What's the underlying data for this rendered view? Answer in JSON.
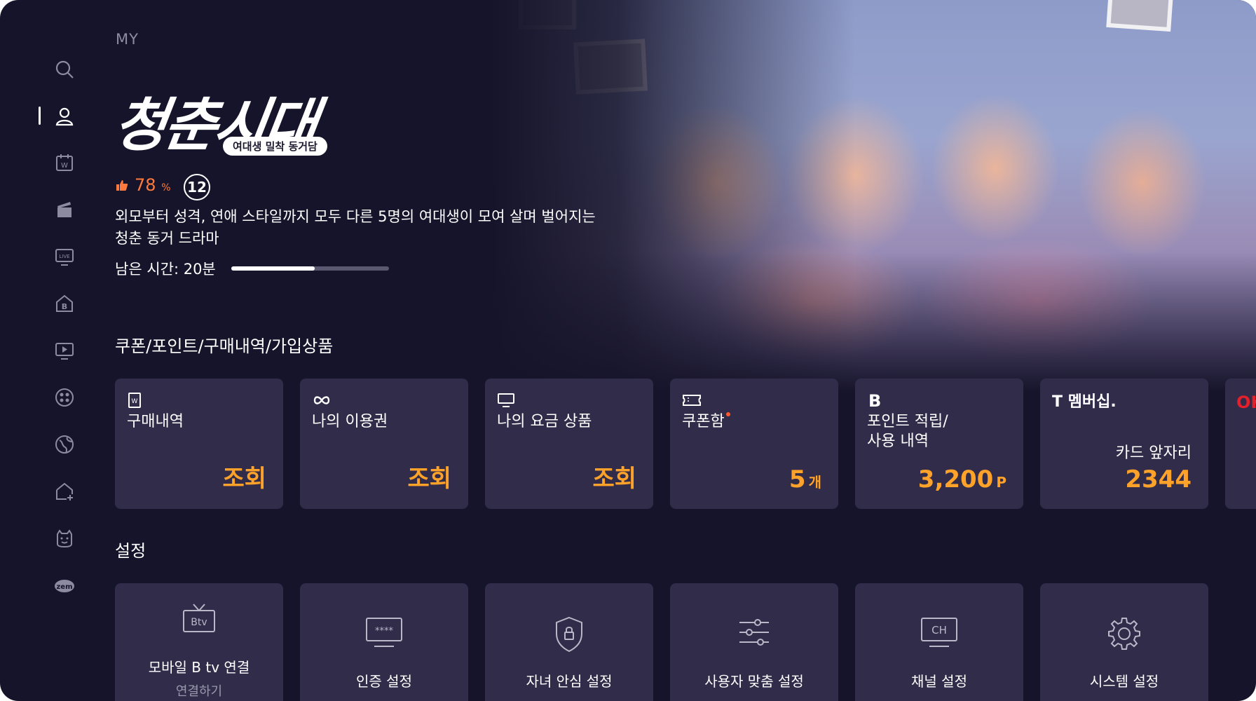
{
  "breadcrumb": "MY",
  "show": {
    "title": "청춘시대",
    "subtitle": "여대생 밀착 동거담",
    "rating_value": "78",
    "rating_unit": "%",
    "age_rating": "12",
    "description": "외모부터 성격, 연애 스타일까지 모두 다른 5명의 여대생이 모여 살며 벌어지는 청춘 동거 드라마",
    "remaining_label": "남은 시간: 20분",
    "progress_fraction": 0.53
  },
  "sidebar": {
    "items": [
      {
        "icon": "search-icon"
      },
      {
        "icon": "user-icon",
        "active": true
      },
      {
        "icon": "calendar-w-icon"
      },
      {
        "icon": "clapperboard-icon"
      },
      {
        "icon": "live-tv-icon"
      },
      {
        "icon": "b-home-icon"
      },
      {
        "icon": "play-screen-icon"
      },
      {
        "icon": "kids-icon"
      },
      {
        "icon": "globe-icon"
      },
      {
        "icon": "home-plus-icon"
      },
      {
        "icon": "character-icon"
      },
      {
        "icon": "zem-icon"
      }
    ]
  },
  "coupon_section": {
    "title": "쿠폰/포인트/구매내역/가입상품",
    "cards": [
      {
        "label": "구매내역",
        "value": "조회",
        "icon": "receipt-w-icon"
      },
      {
        "label": "나의 이용권",
        "value": "조회",
        "icon": "infinity-icon"
      },
      {
        "label": "나의 요금 상품",
        "value": "조회",
        "icon": "monitor-icon"
      },
      {
        "label": "쿠폰함",
        "value": "5",
        "unit": "개",
        "icon": "ticket-icon"
      },
      {
        "label_line1": "포인트 적립/",
        "label_line2": "사용 내역",
        "value": "3,200",
        "unit": "P",
        "icon": "b-logo-icon"
      },
      {
        "brand": "T 멤버십.",
        "sub": "카드 앞자리",
        "value": "2344"
      },
      {
        "brand": "OK"
      }
    ]
  },
  "settings_section": {
    "title": "설정",
    "cards": [
      {
        "label": "모바일 B tv 연결",
        "sub": "연결하기",
        "icon": "btv-tv-icon",
        "icon_text": "Btv"
      },
      {
        "label": "인증 설정",
        "icon": "password-icon",
        "icon_text": "****"
      },
      {
        "label": "자녀 안심 설정",
        "icon": "shield-lock-icon"
      },
      {
        "label": "사용자 맞춤 설정",
        "icon": "sliders-icon"
      },
      {
        "label": "채널 설정",
        "icon": "channel-icon",
        "icon_text": "CH"
      },
      {
        "label": "시스템 설정",
        "icon": "gear-icon"
      }
    ]
  },
  "colors": {
    "background": "#16142a",
    "card": "#302c4a",
    "accent_value": "#ffa22a",
    "rating": "#ff7a3c"
  }
}
